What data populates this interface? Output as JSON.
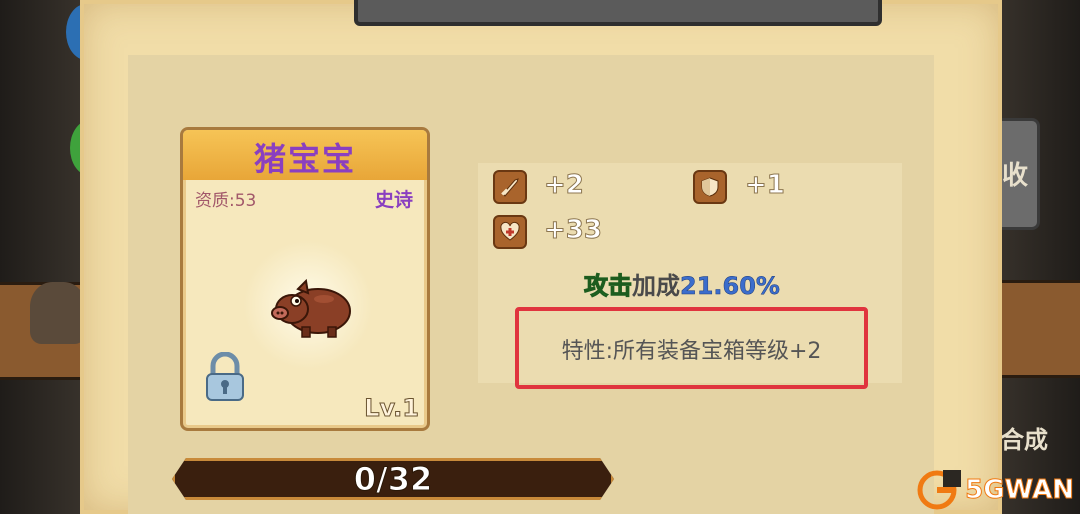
{
  "background": {
    "side_labels": {
      "recycle": "收",
      "compose": "合成"
    }
  },
  "card": {
    "name": "猪宝宝",
    "quality": "资质:53",
    "rarity": "史诗",
    "level": "Lv.1",
    "locked": true
  },
  "stats": {
    "attack": "+2",
    "defense": "+1",
    "health": "+33",
    "bonus_type": "攻击",
    "bonus_label": "加成",
    "bonus_value": "21.60%",
    "trait": "特性:所有装备宝箱等级+2"
  },
  "progress": {
    "text": "0/32",
    "current": 0,
    "max": 32
  },
  "colors": {
    "rarity_purple": "#8a3fc0",
    "attack_green": "#35c23a",
    "bonus_blue": "#3b6dcc",
    "highlight_red": "#e0343e"
  },
  "icons": [
    "sword-icon",
    "shield-icon",
    "heart-icon",
    "lock-icon",
    "pig-icon"
  ]
}
